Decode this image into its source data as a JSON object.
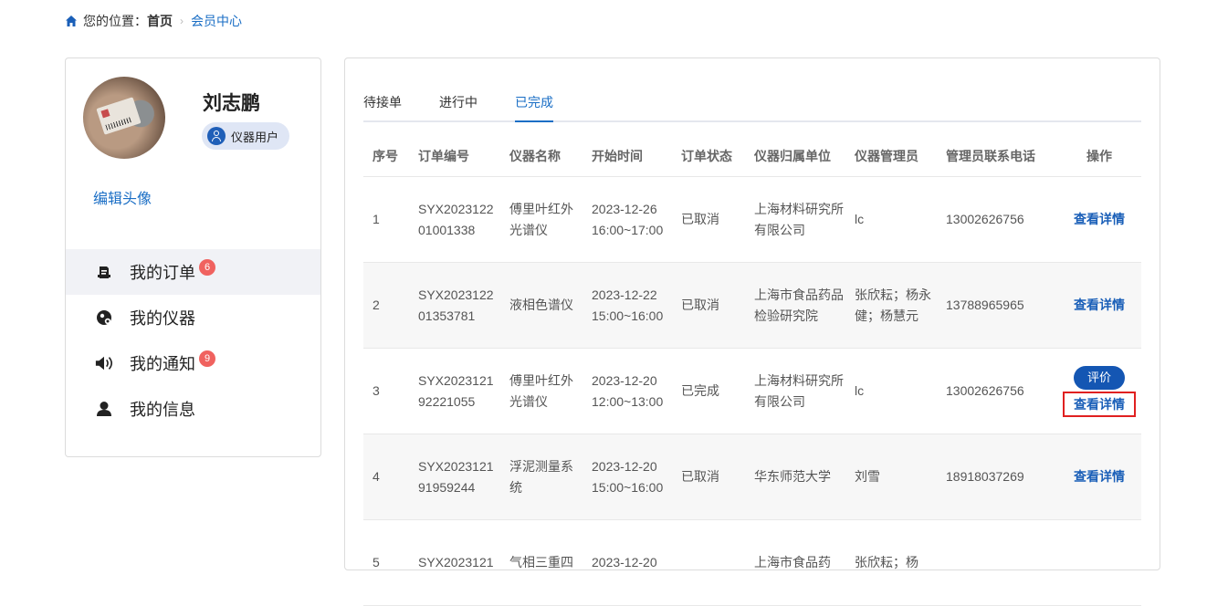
{
  "breadcrumb": {
    "prefix": "您的位置：",
    "home": "首页",
    "separator": "›",
    "current": "会员中心",
    "home_icon": "home-icon"
  },
  "profile": {
    "name": "刘志鹏",
    "role": "仪器用户",
    "edit_avatar": "编辑头像"
  },
  "menu": [
    {
      "label": "我的订单",
      "icon": "orders-icon",
      "badge": "6",
      "active": true
    },
    {
      "label": "我的仪器",
      "icon": "instrument-icon",
      "badge": "",
      "active": false
    },
    {
      "label": "我的通知",
      "icon": "speaker-icon",
      "badge": "9",
      "active": false
    },
    {
      "label": "我的信息",
      "icon": "user-icon",
      "badge": "",
      "active": false
    }
  ],
  "tabs": [
    {
      "label": "待接单",
      "active": false
    },
    {
      "label": "进行中",
      "active": false
    },
    {
      "label": "已完成",
      "active": true
    }
  ],
  "table": {
    "headers": [
      "序号",
      "订单编号",
      "仪器名称",
      "开始时间",
      "订单状态",
      "仪器归属单位",
      "仪器管理员",
      "管理员联系电话",
      "操作"
    ],
    "rows": [
      {
        "no": "1",
        "order_id": "SYX2023122 01001338",
        "instrument": "傅里叶红外光谱仪",
        "start": "2023-12-26 16:00~17:00",
        "status": "已取消",
        "unit": "上海材料研究所有限公司",
        "admin": "lc",
        "phone": "13002626756",
        "detail": "查看详情",
        "rate": ""
      },
      {
        "no": "2",
        "order_id": "SYX2023122 01353781",
        "instrument": "液相色谱仪",
        "start": "2023-12-22 15:00~16:00",
        "status": "已取消",
        "unit": "上海市食品药品检验研究院",
        "admin": "张欣耘；杨永健；杨慧元",
        "phone": "13788965965",
        "detail": "查看详情",
        "rate": ""
      },
      {
        "no": "3",
        "order_id": "SYX2023121 92221055",
        "instrument": "傅里叶红外光谱仪",
        "start": "2023-12-20 12:00~13:00",
        "status": "已完成",
        "unit": "上海材料研究所有限公司",
        "admin": "lc",
        "phone": "13002626756",
        "detail": "查看详情",
        "rate": "评价"
      },
      {
        "no": "4",
        "order_id": "SYX2023121 91959244",
        "instrument": "浮泥测量系统",
        "start": "2023-12-20 15:00~16:00",
        "status": "已取消",
        "unit": "华东师范大学",
        "admin": "刘雪",
        "phone": "18918037269",
        "detail": "查看详情",
        "rate": ""
      },
      {
        "no": "5",
        "order_id": "SYX2023121",
        "instrument": "气相三重四",
        "start": "2023-12-20",
        "status": "",
        "unit": "上海市食品药",
        "admin": "张欣耘；杨",
        "phone": "",
        "detail": "",
        "rate": ""
      }
    ]
  },
  "colors": {
    "accent": "#1a6ec5",
    "badge": "#f0625f",
    "highlight_box": "#e02020",
    "rate_button": "#1456b3"
  }
}
